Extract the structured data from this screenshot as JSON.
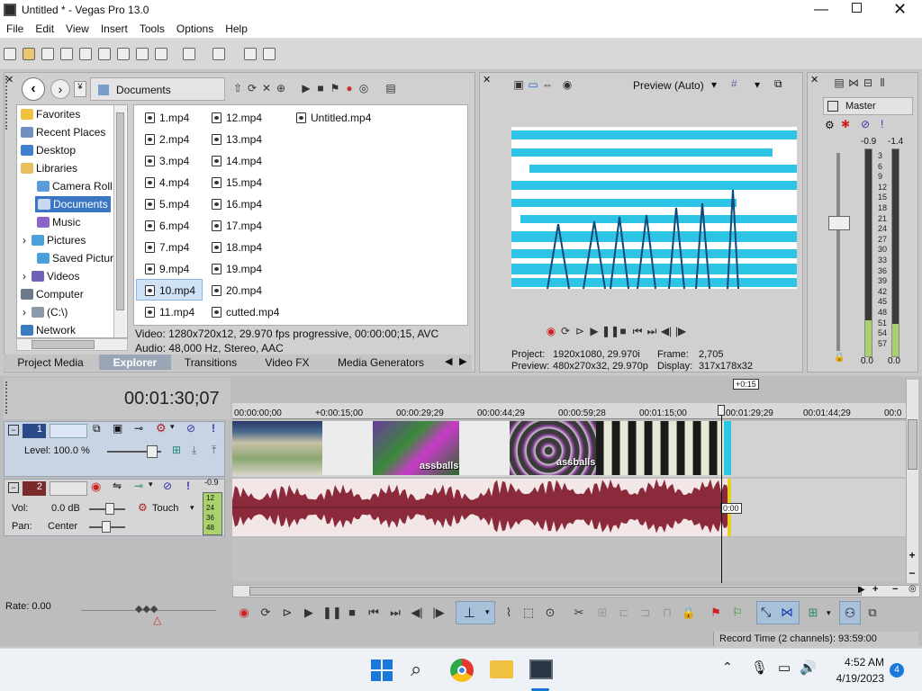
{
  "window": {
    "title": "Untitled * - Vegas Pro 13.0"
  },
  "menu": [
    "File",
    "Edit",
    "View",
    "Insert",
    "Tools",
    "Options",
    "Help"
  ],
  "explorer": {
    "path": "Documents",
    "tree": [
      "Favorites",
      "Recent Places",
      "Desktop",
      "Libraries",
      "Camera Roll",
      "Documents",
      "Music",
      "Pictures",
      "Saved Pictur",
      "Videos",
      "Computer",
      "(C:\\)",
      "Network"
    ],
    "files_col1": [
      "1.mp4",
      "2.mp4",
      "3.mp4",
      "4.mp4",
      "5.mp4",
      "6.mp4",
      "7.mp4",
      "9.mp4",
      "10.mp4",
      "11.mp4"
    ],
    "files_col2": [
      "12.mp4",
      "13.mp4",
      "14.mp4",
      "15.mp4",
      "16.mp4",
      "17.mp4",
      "18.mp4",
      "19.mp4",
      "20.mp4",
      "cutted.mp4"
    ],
    "files_col3": [
      "Untitled.mp4"
    ],
    "info_video": "Video: 1280x720x12, 29.970 fps progressive, 00:00:00;15, AVC",
    "info_audio": "Audio: 48,000 Hz, Stereo, AAC"
  },
  "tabs": [
    "Project Media",
    "Explorer",
    "Transitions",
    "Video FX",
    "Media Generators"
  ],
  "preview": {
    "mode": "Preview (Auto)",
    "project_label": "Project:",
    "project": "1920x1080, 29.970i",
    "frame_label": "Frame:",
    "frame": "2,705",
    "preview_label": "Preview:",
    "preview": "480x270x32, 29.970p",
    "display_label": "Display:",
    "display": "317x178x32"
  },
  "mixer": {
    "title": "Master",
    "peak_l": "-0.9",
    "peak_r": "-1.4",
    "scale": [
      "3",
      "6",
      "9",
      "12",
      "15",
      "18",
      "21",
      "24",
      "27",
      "30",
      "33",
      "36",
      "39",
      "42",
      "45",
      "48",
      "51",
      "54",
      "57"
    ],
    "bottom_l": "0.0",
    "bottom_r": "0.0"
  },
  "timeline": {
    "timecode": "00:01:30;07",
    "cursor_label": "+0:15",
    "ruler": [
      "00:00:00;00",
      "+0:00:15;00",
      "00:00:29;29",
      "00:00:44;29",
      "00:00:59;28",
      "00:01:15;00",
      "00:01:29;29",
      "00:01:44;29",
      "00:0"
    ],
    "track1": {
      "num": "1",
      "level_label": "Level: 100.0 %"
    },
    "track2": {
      "num": "2",
      "vol_label": "Vol:",
      "vol": "0.0 dB",
      "pan_label": "Pan:",
      "pan": "Center",
      "mode": "Touch",
      "meter_top": "-0.9",
      "meter_scale": [
        "12",
        "24",
        "36",
        "48"
      ]
    },
    "clip_labels": [
      "assballs",
      "assballs"
    ],
    "audio_marker": "0:00",
    "rate": "Rate: 0.00",
    "record_time": "Record Time (2 channels): 93:59:00"
  },
  "taskbar": {
    "time": "4:52 AM",
    "date": "4/19/2023",
    "badge": "4"
  }
}
